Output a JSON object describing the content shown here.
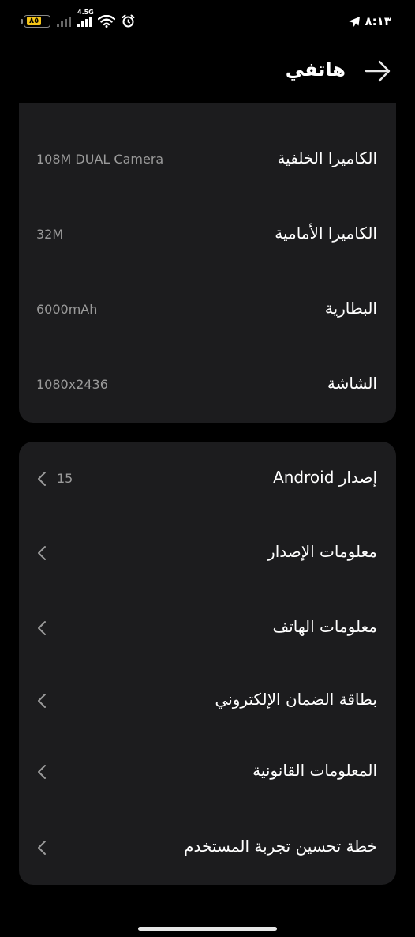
{
  "status_bar": {
    "battery_level": "٨٥",
    "network_type": "4.5G",
    "time": "٨:١٣",
    "icons": [
      "battery-icon",
      "signal-weak-icon",
      "signal-strong-icon",
      "wifi-icon",
      "alarm-icon",
      "telegram-icon"
    ]
  },
  "header": {
    "title": "هاتفي",
    "back_icon": "arrow-right-icon"
  },
  "specs": [
    {
      "label": "الكاميرا الخلفية",
      "value": "108M DUAL Camera"
    },
    {
      "label": "الكاميرا الأمامية",
      "value": "32M"
    },
    {
      "label": "البطارية",
      "value": "6000mAh"
    },
    {
      "label": "الشاشة",
      "value": "1080x2436"
    }
  ],
  "menu": [
    {
      "label": "إصدار Android",
      "value": "15"
    },
    {
      "label": "معلومات الإصدار"
    },
    {
      "label": "معلومات الهاتف"
    },
    {
      "label": "بطاقة الضمان الإلكتروني"
    },
    {
      "label": "المعلومات القانونية"
    },
    {
      "label": "خطة تحسين تجربة المستخدم"
    }
  ],
  "colors": {
    "background": "#000000",
    "card": "#1c1c1e",
    "secondary_text": "#9a9a9a",
    "battery_accent": "#f5c518"
  }
}
